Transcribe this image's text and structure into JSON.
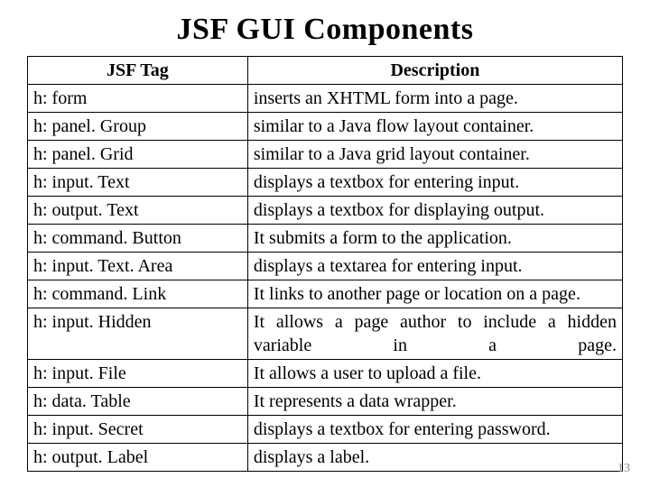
{
  "title": "JSF GUI Components",
  "headers": {
    "tag": "JSF Tag",
    "desc": "Description"
  },
  "rows": [
    {
      "tag": "h: form",
      "desc": "inserts an XHTML form into a page.",
      "justify": false
    },
    {
      "tag": "h: panel. Group",
      "desc": "similar to a Java flow layout container.",
      "justify": false
    },
    {
      "tag": "h: panel. Grid",
      "desc": "similar to a Java grid layout container.",
      "justify": false
    },
    {
      "tag": "h: input. Text",
      "desc": "displays a textbox for entering input.",
      "justify": false
    },
    {
      "tag": "h: output. Text",
      "desc": "displays a textbox for displaying output.",
      "justify": false
    },
    {
      "tag": "h: command. Button",
      "desc": "It submits a form to the application.",
      "justify": false
    },
    {
      "tag": "h: input. Text. Area",
      "desc": "displays a textarea for entering input.",
      "justify": false
    },
    {
      "tag": "h: command. Link",
      "desc": "It links to another page or location on a page.",
      "justify": false
    },
    {
      "tag": "h: input. Hidden",
      "desc": "It allows a page author to include a hidden variable in a page.",
      "justify": true
    },
    {
      "tag": "h: input. File",
      "desc": "It allows a user to upload a file.",
      "justify": false
    },
    {
      "tag": "h: data. Table",
      "desc": "It represents a data wrapper.",
      "justify": false
    },
    {
      "tag": "h: input. Secret",
      "desc": "displays a textbox for entering password.",
      "justify": false
    },
    {
      "tag": "h: output. Label",
      "desc": "displays a label.",
      "justify": false
    }
  ],
  "pageNumber": "13"
}
